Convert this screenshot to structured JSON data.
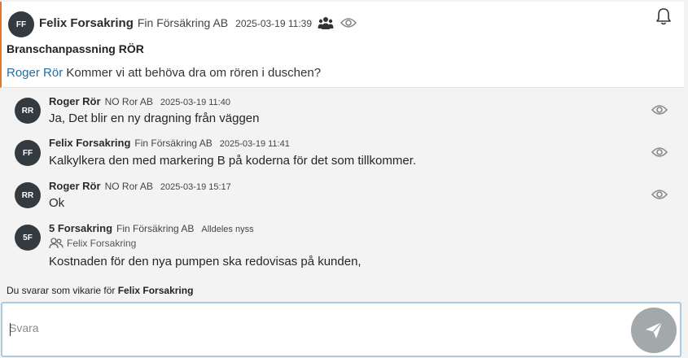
{
  "thread": {
    "avatar_initials": "FF",
    "author": "Felix Forsakring",
    "company": "Fin Försäkring AB",
    "date": "2025-03-19 11:39",
    "title": "Branschanpassning RÖR",
    "mention": "Roger Rör",
    "body": "Kommer vi att behöva dra om rören i duschen?",
    "icons": [
      "group-icon",
      "eye-icon",
      "bell-icon"
    ]
  },
  "replies": [
    {
      "avatar_initials": "RR",
      "author": "Roger Rör",
      "company": "NO Ror AB",
      "date": "2025-03-19 11:40",
      "text": "Ja, Det blir en ny dragning från väggen"
    },
    {
      "avatar_initials": "FF",
      "author": "Felix Forsakring",
      "company": "Fin Försäkring AB",
      "date": "2025-03-19 11:41",
      "text": "Kalkylkera den med markering B på koderna för det som tillkommer."
    },
    {
      "avatar_initials": "RR",
      "author": "Roger Rör",
      "company": "NO Ror AB",
      "date": "2025-03-19 15:17",
      "text": "Ok"
    },
    {
      "avatar_initials": "5F",
      "author": "5 Forsakring",
      "company": "Fin Försäkring AB",
      "date": "Alldeles nyss",
      "on_behalf_of": "Felix Forsakring",
      "text": "Kostnaden för den nya pumpen ska redovisas på kunden,"
    }
  ],
  "composer": {
    "vikarie_prefix": "Du svarar som vikarie för",
    "vikarie_name": "Felix Forsakring",
    "placeholder": "Svara",
    "value": ""
  },
  "colors": {
    "avatar_bg": "#333a40",
    "accent_left_border": "#e07a2e",
    "mention": "#1e6fa8",
    "send_button": "#a3a8ab",
    "input_border": "#a9cbe3"
  }
}
